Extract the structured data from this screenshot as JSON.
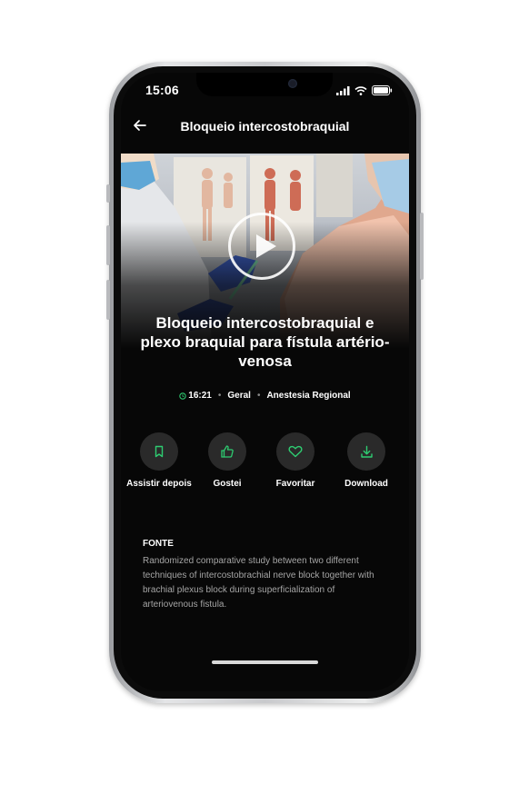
{
  "status_bar": {
    "time": "15:06"
  },
  "app_bar": {
    "title": "Bloqueio intercostobraquial"
  },
  "video": {
    "title": "Bloqueio intercostobraquial e plexo braquial para fístula artério-venosa",
    "duration": "16:21",
    "category": "Geral",
    "topic": "Anestesia Regional"
  },
  "actions": [
    {
      "label": "Assistir depois",
      "icon": "bookmark-icon"
    },
    {
      "label": "Gostei",
      "icon": "thumbs-up-icon"
    },
    {
      "label": "Favoritar",
      "icon": "heart-icon"
    },
    {
      "label": "Download",
      "icon": "download-icon"
    }
  ],
  "source": {
    "heading": "FONTE",
    "text": "Randomized comparative study between two different techniques of intercostobrachial nerve block together with brachial plexus block during superficialization of arteriovenous fistula."
  },
  "colors": {
    "accent": "#2ecc71",
    "background": "#070707",
    "action_bg": "#2a2a2a"
  }
}
